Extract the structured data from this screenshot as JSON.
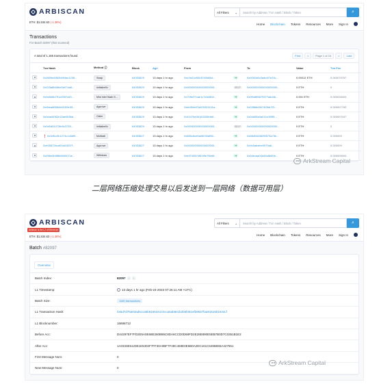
{
  "header": {
    "logo": "ARBISCAN",
    "eth_label": "ETH: $1,534.63",
    "eth_change": "(-1.36%)",
    "filter": "All Filters",
    "search_placeholder": "Search by Address / Txn Hash / Block / Token",
    "nav": [
      "Home",
      "Blockchain",
      "Tokens",
      "Resources",
      "More",
      "Sign In"
    ]
  },
  "transactions_page": {
    "title": "Transactions",
    "subtitle": "For Batch 82097 (this scanned)",
    "count_text": "A total of 1,165 transactions found",
    "pager": [
      "First",
      "<",
      "Page 1 of 24",
      ">",
      "Last"
    ],
    "columns": [
      "Txn Hash",
      "Method",
      "Block",
      "Age",
      "From",
      "",
      "To",
      "Value",
      "Txn Fee"
    ],
    "rows": [
      {
        "hash": "0x0659e8362b694ac1236...",
        "err": false,
        "method": "Swap",
        "block": "64053829",
        "age": "13 days 1 hr ago",
        "from": "0xe2a21c8619292b88d...",
        "dir": "arrow",
        "to": "0x0052d6c3adc4f7e23c...",
        "value": "0.00012 ETH",
        "fee": "0.000079767"
      },
      {
        "hash": "0x023a8b08be5e07da6...",
        "err": false,
        "method": "Initialize0x",
        "block": "64053829",
        "age": "13 days 1 hr ago",
        "from": "0x000000000000000000...",
        "dir": "self",
        "to": "0x000000000000000000...",
        "value": "0 ETH",
        "fee": "0"
      },
      {
        "hash": "0x0e6b8b791c0557c63...",
        "err": false,
        "method": "Mint Intel State G...",
        "block": "64053829",
        "age": "13 days 1 hr ago",
        "from": "0x709e37cae1c7eb45b0...",
        "dir": "arrow",
        "to": "0x0f9df65675377a6d4b...",
        "value": "0.001 ETH",
        "fee": "0.000034003"
      },
      {
        "hash": "0x0bea8f55b4e0159e33...",
        "err": false,
        "method": "Approve",
        "block": "64053829",
        "age": "13 days 1 hr ago",
        "from": "0xfe450e67a929331131a...",
        "dir": "arrow",
        "to": "0x03f8db0f474f2bb7f3...",
        "value": "0 ETH",
        "fee": "0.000007762"
      },
      {
        "hash": "0x0eae6062e15ae0b5bd...",
        "err": false,
        "method": "Claim",
        "block": "64053829",
        "age": "13 days 1 hr ago",
        "from": "0x4147be0b163205bfa9...",
        "dir": "arrow",
        "to": "0x0da55a0a011c059f5...",
        "value": "0 ETH",
        "fee": "0.000007047"
      },
      {
        "hash": "0x0d0d51073fe5c3735...",
        "err": false,
        "method": "Initialize0x",
        "block": "64053829",
        "age": "13 days 1 hr ago",
        "from": "0x000000000000000000...",
        "dir": "self",
        "to": "0x000000000000000000...",
        "value": "0 ETH",
        "fee": "0"
      },
      {
        "hash": "0x0df1c9b1274c1c6df9...",
        "err": true,
        "method": "Multicall",
        "block": "64053827",
        "age": "13 days 1 hr ago",
        "from": "0x865c6ce6a06030af56...",
        "dir": "arrow",
        "to": "0x68d0483825f573a75e...",
        "value": "0 ETH",
        "fee": "0.000009"
      },
      {
        "hash": "0xe05872bcd03a01837f...",
        "err": false,
        "method": "Approve",
        "block": "64053827",
        "age": "13 days 1 hr ago",
        "from": "0x000000000000000000...",
        "dir": "arrow",
        "to": "0x9c5afcebe9979a6...",
        "value": "0 ETH",
        "fee": "0.000009"
      },
      {
        "hash": "0x096e0b5f8b6b5007ce...",
        "err": false,
        "method": "Withdraw",
        "block": "64053827",
        "age": "13 days 1 hr ago",
        "from": "0xe5749874f61f9e7f6e6f...",
        "dir": "arrow",
        "to": "0x0decaa04d49a6b50b...",
        "value": "0 ETH",
        "fee": "0.000009003"
      }
    ]
  },
  "caption": "二层网络压缩处理交易以后发送到一层网络（数据可用层）",
  "watermark": "ArkStream Capital",
  "batch_page": {
    "ribbon": "Arbitrum is the L2 of Ethereum",
    "title": "Batch",
    "batch_id": "#82097",
    "tab": "Overview",
    "rows": [
      {
        "key": "Batch Index:",
        "value": "82097"
      },
      {
        "key": "L1 Timestamp:",
        "value": "13 days 1 hr ago (Feb-24-2023 07:26:11 AM +UTC)"
      },
      {
        "key": "Batch Size:",
        "value": "1165 transactions"
      },
      {
        "key": "L1 Transaction Hash:",
        "value": "0x5d7d75a03ad6cca6b6155341c0cca5ab8e1b2b6f351efb9637faa91516b1644cf"
      },
      {
        "key": "L1 Blocknumber:",
        "value": "16696712"
      },
      {
        "key": "Before Acc:",
        "value": "D44297EF7FD2E5A0E68E260B86C8DA6CCD0D68FD2E28E890E5EB7B0D7C0351B1E2"
      },
      {
        "key": "After Acc:",
        "value": "1A0333E5120E1E5302F7FF30A0BF7F48C468E0E5B0A2DC161C6495B55A427551"
      },
      {
        "key": "First Message Num:",
        "value": "0"
      },
      {
        "key": "New Message Num:",
        "value": "0"
      }
    ]
  }
}
